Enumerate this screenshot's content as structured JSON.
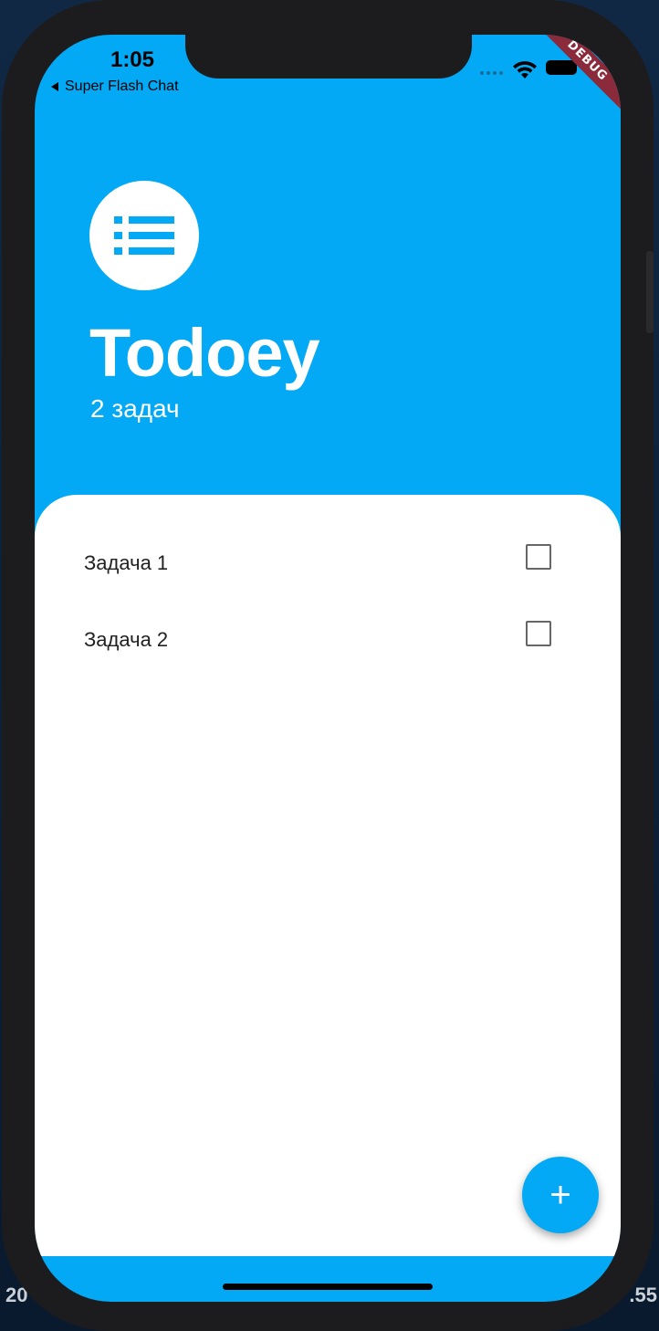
{
  "desktop": {
    "edge_left_text": "20",
    "edge_right_text": ".55"
  },
  "status_bar": {
    "time": "1:05",
    "back_label": "Super Flash Chat",
    "debug_banner": "DEBUG"
  },
  "header": {
    "logo_icon": "list-icon",
    "title": "Todoey",
    "task_count": "2 задач"
  },
  "tasks": [
    {
      "label": "Задача 1",
      "checked": false
    },
    {
      "label": "Задача 2",
      "checked": false
    }
  ],
  "fab": {
    "icon": "plus-icon",
    "symbol": "+"
  },
  "colors": {
    "accent": "#03a9f4",
    "debug_banner": "#8b2a3a",
    "sheet": "#ffffff"
  }
}
